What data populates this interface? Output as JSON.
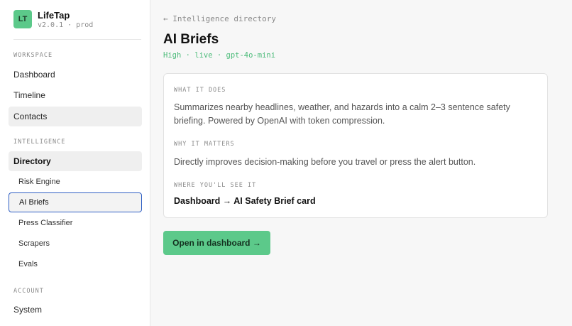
{
  "brand": {
    "badge": "LT",
    "name": "LifeTap",
    "version": "v2.0.1 · prod"
  },
  "sidebar": {
    "workspace": {
      "label": "WORKSPACE",
      "items": [
        {
          "label": "Dashboard"
        },
        {
          "label": "Timeline"
        },
        {
          "label": "Contacts"
        }
      ]
    },
    "intelligence": {
      "label": "INTELLIGENCE",
      "directory": {
        "label": "Directory"
      },
      "items": [
        {
          "label": "Risk Engine"
        },
        {
          "label": "AI Briefs"
        },
        {
          "label": "Press Classifier"
        },
        {
          "label": "Scrapers"
        },
        {
          "label": "Evals"
        }
      ]
    },
    "account": {
      "label": "ACCOUNT",
      "items": [
        {
          "label": "System"
        }
      ]
    }
  },
  "main": {
    "back_link": "← Intelligence directory",
    "title": "AI Briefs",
    "meta": "High · live · gpt-4o-mini",
    "card": {
      "what_label": "WHAT IT DOES",
      "what_text": "Summarizes nearby headlines, weather, and hazards into a calm 2–3 sentence safety briefing. Powered by OpenAI with token compression.",
      "why_label": "WHY IT MATTERS",
      "why_text": "Directly improves decision-making before you travel or press the alert button.",
      "where_label": "WHERE YOU'LL SEE IT",
      "where_text": "Dashboard → AI Safety Brief card"
    },
    "open_button": "Open in dashboard →"
  },
  "colors": {
    "accent_green": "#5cc98a",
    "meta_green": "#4cbb7a",
    "selected_border": "#2f5fc4"
  }
}
